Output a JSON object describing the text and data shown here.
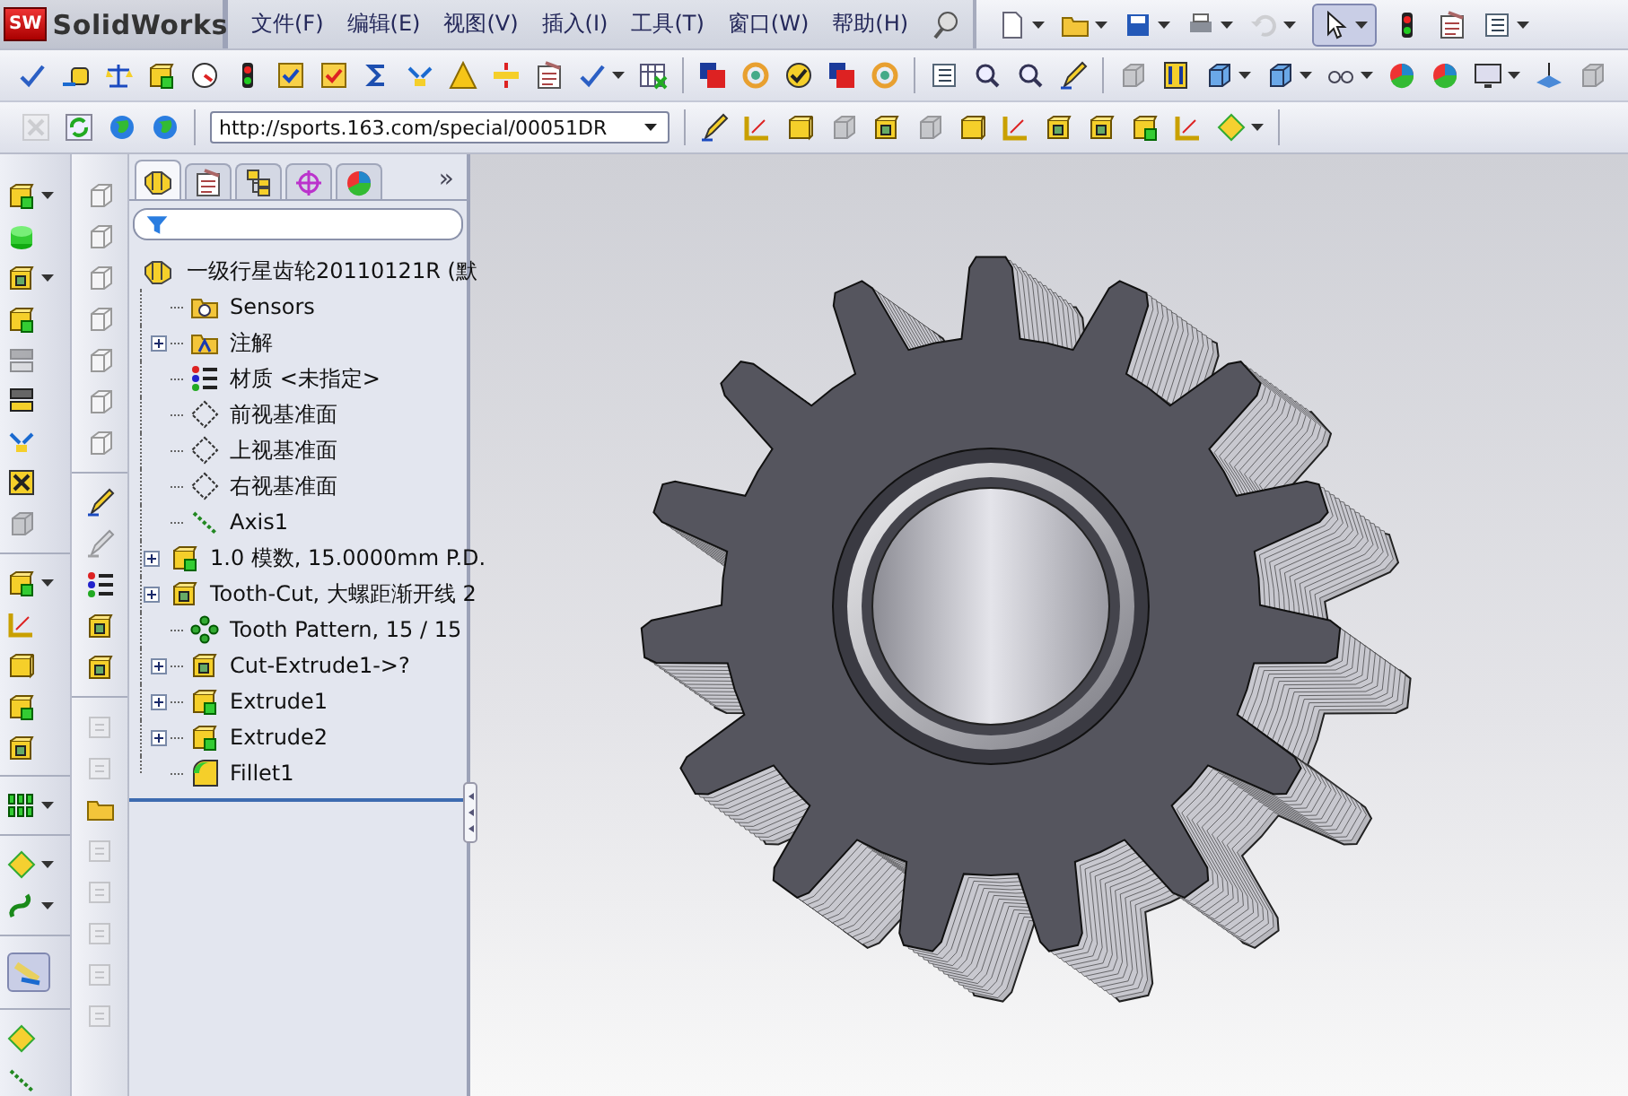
{
  "app": {
    "logo_mark": "SW",
    "title": "SolidWorks"
  },
  "menus": [
    "文件(F)",
    "编辑(E)",
    "视图(V)",
    "插入(I)",
    "工具(T)",
    "窗口(W)",
    "帮助(H)"
  ],
  "url_field": {
    "value": "http://sports.163.com/special/00051DR"
  },
  "panel_tabs": [
    {
      "kind": "feature",
      "selected": true
    },
    {
      "kind": "property",
      "selected": false
    },
    {
      "kind": "config",
      "selected": false
    },
    {
      "kind": "target",
      "selected": false
    },
    {
      "kind": "appearance",
      "selected": false
    }
  ],
  "panel_overflow": "»",
  "tree": {
    "root": {
      "kind": "part",
      "label": "一级行星齿轮20110121R (默"
    },
    "items": [
      {
        "kind": "sensor-folder",
        "label": "Sensors",
        "collapsible": false
      },
      {
        "kind": "annotation-folder",
        "label": "注解",
        "collapsible": true
      },
      {
        "kind": "material",
        "label": "材质 <未指定>",
        "collapsible": false
      },
      {
        "kind": "plane",
        "label": "前视基准面",
        "collapsible": false
      },
      {
        "kind": "plane",
        "label": "上视基准面",
        "collapsible": false
      },
      {
        "kind": "plane",
        "label": "右视基准面",
        "collapsible": false
      },
      {
        "kind": "axis",
        "label": "Axis1",
        "collapsible": false
      },
      {
        "kind": "feature",
        "label": "1.0 模数, 15.0000mm P.D.",
        "collapsible": true
      },
      {
        "kind": "cut",
        "label": "Tooth-Cut, 大螺距渐开线 2",
        "collapsible": true
      },
      {
        "kind": "pattern",
        "label": "Tooth Pattern, 15 / 15",
        "collapsible": false
      },
      {
        "kind": "cut",
        "label": "Cut-Extrude1->?",
        "collapsible": true
      },
      {
        "kind": "feature",
        "label": "Extrude1",
        "collapsible": true
      },
      {
        "kind": "feature",
        "label": "Extrude2",
        "collapsible": true
      },
      {
        "kind": "fillet",
        "label": "Fillet1",
        "collapsible": false
      }
    ]
  }
}
